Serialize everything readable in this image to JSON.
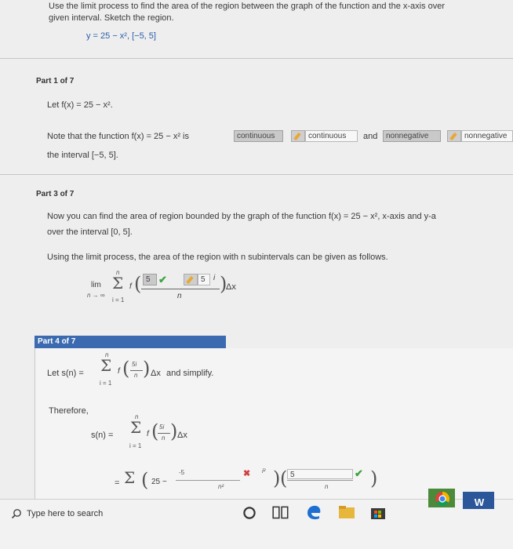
{
  "question": {
    "prompt_line1": "Use the limit process to find the area of the region between the graph of the function and the x-axis over",
    "prompt_line2": "given interval. Sketch the region.",
    "function_text": "y = 25 − x², [−5, 5]"
  },
  "part1": {
    "heading": "Part 1 of 7",
    "let_text": "Let f(x) = 25 − x².",
    "note_prefix": "Note that the function f(x) = 25 − x² is",
    "answer1": "continuous",
    "answer1_feedback": "continuous",
    "and_text": "and",
    "answer2": "nonnegative",
    "answer2_feedback": "nonnegative",
    "interval_text": "the interval [−5, 5]."
  },
  "part3": {
    "heading": "Part 3 of 7",
    "line1": "Now you can find the area of region bounded by the graph of the function f(x) = 25 − x², x-axis and y-a",
    "line2": "over the interval [0, 5].",
    "line3": "Using the limit process, the area of the region with n subintervals can be given as follows.",
    "lim": "lim",
    "lim_sub": "n → ∞",
    "sigma_top": "n",
    "sigma_bottom": "i = 1",
    "f_label": "f",
    "answer_num": "5",
    "feedback_num": "5",
    "i_label": "i",
    "denominator": "n",
    "delta_x": "Δx"
  },
  "part4": {
    "heading": "Part 4 of 7",
    "let_prefix": "Let s(n) =",
    "sigma_top": "n",
    "sigma_bottom": "i = 1",
    "f_label": "f",
    "frac_num": "5i",
    "frac_den": "n",
    "delta_x": "Δx",
    "and_simplify": "and simplify.",
    "therefore": "Therefore,",
    "s_of_n": "s(n) =",
    "eq_sign": "=",
    "const_25": "25 −",
    "answer_a": "-5",
    "answer_a_den": "n²",
    "exponent": "i²",
    "answer_b": "5",
    "answer_b_den": "n"
  },
  "taskbar": {
    "search_placeholder": "Type here to search",
    "search_icon": "search-icon",
    "cortana_icon": "cortana-circle-icon",
    "taskview_icon": "task-view-icon",
    "edge_icon": "edge-icon",
    "explorer_icon": "file-explorer-icon",
    "store_icon": "store-icon",
    "chrome_icon": "chrome-icon",
    "word_icon": "word-icon"
  },
  "colors": {
    "part4_header": "#3c6ab0",
    "blue_text": "#2a5ea8",
    "check_green": "#3ea33e",
    "cross_red": "#d04040"
  }
}
